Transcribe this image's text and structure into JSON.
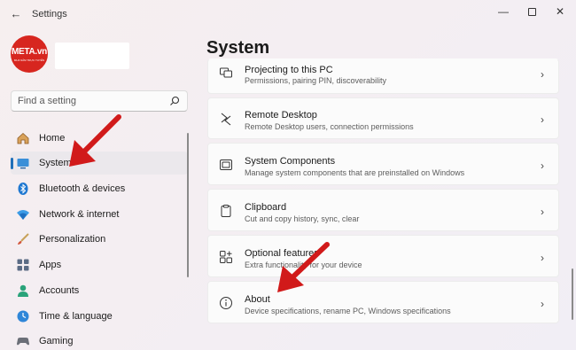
{
  "window": {
    "title": "Settings",
    "back_glyph": "←",
    "min_glyph": "—",
    "close_glyph": "✕"
  },
  "logo": {
    "text": "META.vn",
    "subtext": "MUA SẮM TRỰC TUYẾN",
    "color": "#d7261f"
  },
  "search": {
    "placeholder": "Find a setting"
  },
  "nav": {
    "items": [
      {
        "label": "Home",
        "icon": "home-icon"
      },
      {
        "label": "System",
        "icon": "system-icon",
        "selected": true
      },
      {
        "label": "Bluetooth & devices",
        "icon": "bluetooth-icon"
      },
      {
        "label": "Network & internet",
        "icon": "wifi-icon"
      },
      {
        "label": "Personalization",
        "icon": "brush-icon"
      },
      {
        "label": "Apps",
        "icon": "apps-icon"
      },
      {
        "label": "Accounts",
        "icon": "accounts-icon"
      },
      {
        "label": "Time & language",
        "icon": "time-language-icon"
      },
      {
        "label": "Gaming",
        "icon": "gaming-icon"
      }
    ]
  },
  "main": {
    "title": "System",
    "cards": [
      {
        "title": "Projecting to this PC",
        "desc": "Permissions, pairing PIN, discoverability",
        "icon": "projecting-icon"
      },
      {
        "title": "Remote Desktop",
        "desc": "Remote Desktop users, connection permissions",
        "icon": "remote-desktop-icon"
      },
      {
        "title": "System Components",
        "desc": "Manage system components that are preinstalled on Windows",
        "icon": "system-components-icon"
      },
      {
        "title": "Clipboard",
        "desc": "Cut and copy history, sync, clear",
        "icon": "clipboard-icon"
      },
      {
        "title": "Optional features",
        "desc": "Extra functionality for your device",
        "icon": "optional-features-icon"
      },
      {
        "title": "About",
        "desc": "Device specifications, rename PC, Windows specifications",
        "icon": "about-icon"
      }
    ]
  },
  "colors": {
    "accent": "#1f6fb8",
    "annotation_arrow": "#d11a1a"
  }
}
